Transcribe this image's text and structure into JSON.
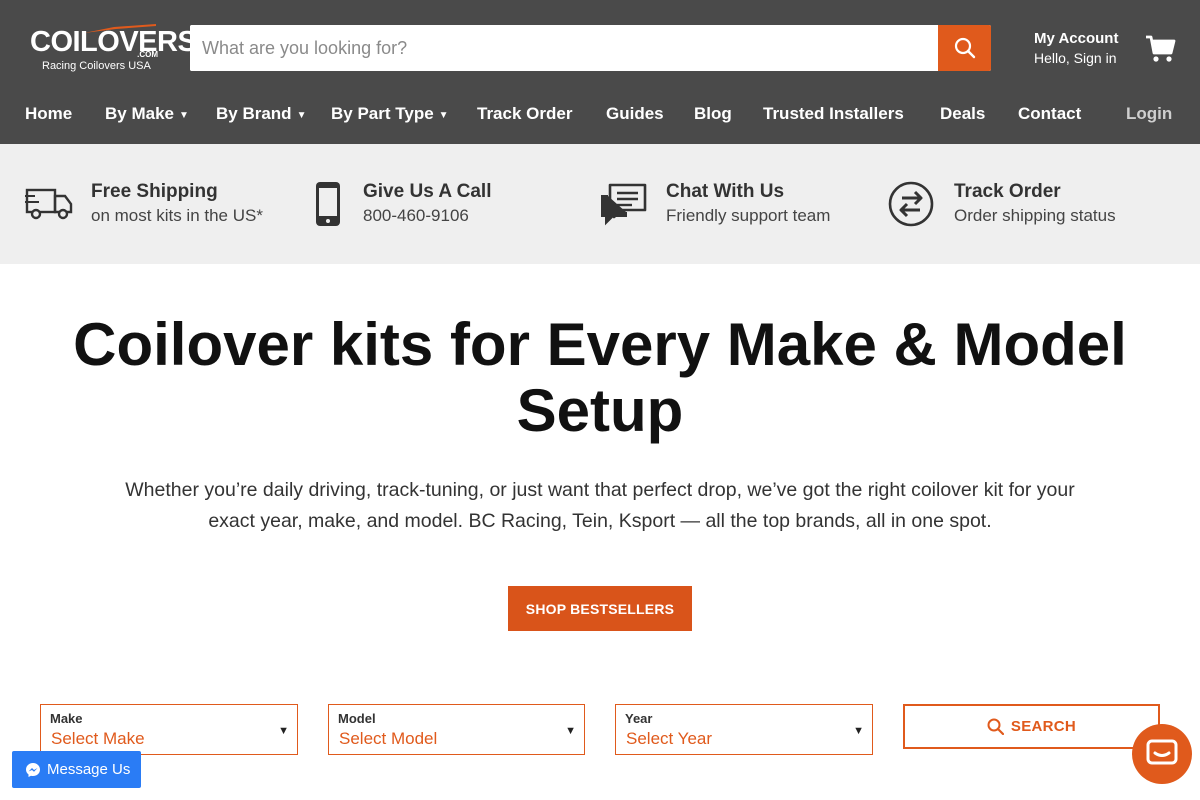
{
  "brand": {
    "logo_main": "COILOVERS",
    "logo_dotcom": ".COM",
    "logo_sub": "Racing Coilovers USA"
  },
  "header": {
    "search_placeholder": "What are you looking for?",
    "account_title": "My Account",
    "account_sub": "Hello, Sign in"
  },
  "nav": {
    "items": [
      {
        "label": "Home"
      },
      {
        "label": "By Make",
        "dropdown": true
      },
      {
        "label": "By Brand",
        "dropdown": true
      },
      {
        "label": "By Part Type",
        "dropdown": true
      },
      {
        "label": "Track Order"
      },
      {
        "label": "Guides"
      },
      {
        "label": "Blog"
      },
      {
        "label": "Trusted Installers"
      },
      {
        "label": "Deals"
      },
      {
        "label": "Contact"
      }
    ],
    "login": "Login"
  },
  "features": [
    {
      "icon": "truck-icon",
      "title": "Free Shipping",
      "subtitle": "on most kits in the US*"
    },
    {
      "icon": "phone-icon",
      "title": "Give Us A Call",
      "subtitle": "800-460-9106"
    },
    {
      "icon": "chat-icon",
      "title": "Chat With Us",
      "subtitle": "Friendly support team"
    },
    {
      "icon": "arrows-icon",
      "title": "Track Order",
      "subtitle": "Order shipping status"
    }
  ],
  "hero": {
    "title": "Coilover kits for Every Make & Model Setup",
    "description": "Whether you’re daily driving, track-tuning, or just want that perfect drop, we’ve got the right coilover kit for your exact year, make, and model. BC Racing, Tein, Ksport — all the top brands, all in one spot.",
    "cta": "Shop Bestsellers"
  },
  "finder": {
    "make": {
      "label": "Make",
      "value": "Select Make"
    },
    "model": {
      "label": "Model",
      "value": "Select Model"
    },
    "year": {
      "label": "Year",
      "value": "Select Year"
    },
    "search_label": "SEARCH"
  },
  "messenger": {
    "label": "Message Us"
  },
  "colors": {
    "accent": "#e05a1c",
    "header_bg": "#4a4a4a",
    "features_bg": "#efefef",
    "messenger": "#2a7cf5"
  }
}
